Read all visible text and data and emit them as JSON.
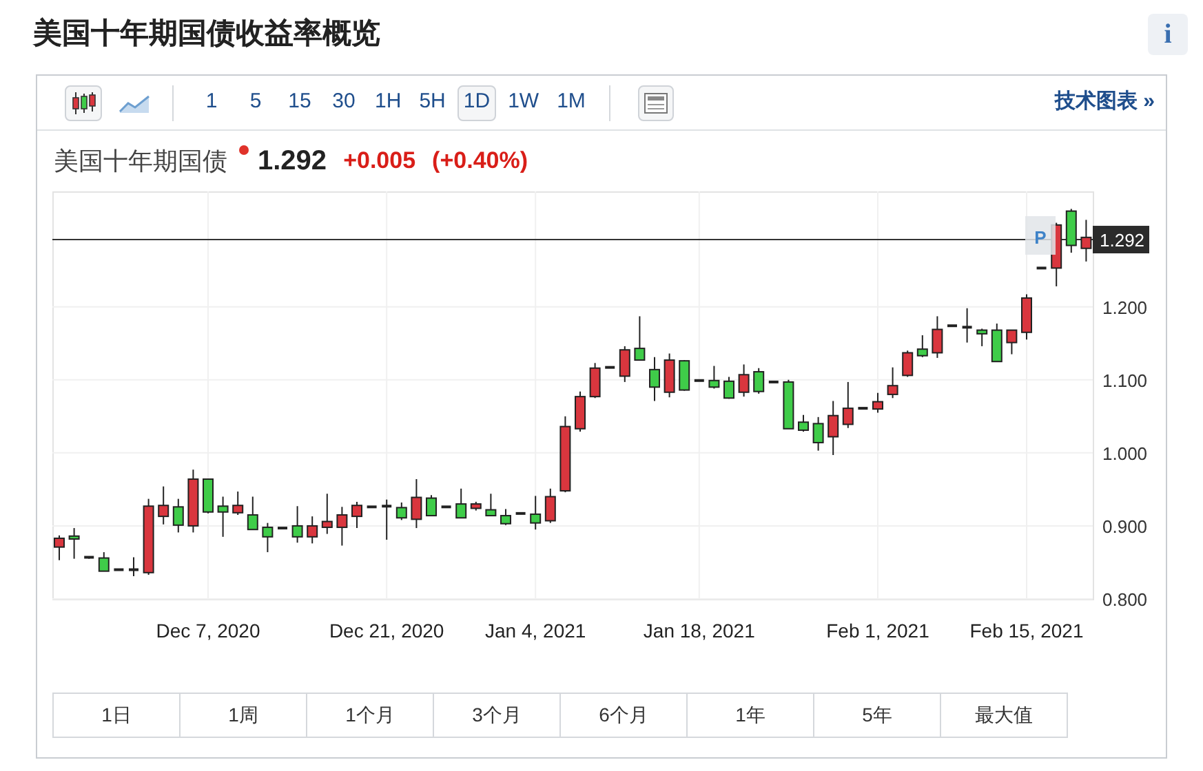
{
  "page_title": "美国十年期国债收益率概览",
  "info_button": {
    "label": "i"
  },
  "toolbar": {
    "chart_types": [
      {
        "kind": "candles",
        "selected": true
      },
      {
        "kind": "area",
        "selected": false
      }
    ],
    "intervals": [
      {
        "label": "1",
        "selected": false
      },
      {
        "label": "5",
        "selected": false
      },
      {
        "label": "15",
        "selected": false
      },
      {
        "label": "30",
        "selected": false
      },
      {
        "label": "1H",
        "selected": false
      },
      {
        "label": "5H",
        "selected": false
      },
      {
        "label": "1D",
        "selected": true
      },
      {
        "label": "1W",
        "selected": false
      },
      {
        "label": "1M",
        "selected": false
      }
    ],
    "technical_link": "技术图表 »"
  },
  "quote": {
    "name": "美国十年期国债",
    "price": "1.292",
    "change": "+0.005",
    "change_percent": "(+0.40%)"
  },
  "chart": {
    "marker": "P",
    "chart_data": {
      "type": "candlestick",
      "ylim": [
        0.8,
        1.358
      ],
      "grid": true,
      "ref_lines": [
        {
          "axis": "y",
          "value": 1.292,
          "label": "1.292"
        }
      ],
      "yticks": [
        {
          "value": 1.2,
          "label": "1.200"
        },
        {
          "value": 1.1,
          "label": "1.100"
        },
        {
          "value": 1.0,
          "label": "1.000"
        },
        {
          "value": 0.9,
          "label": "0.900"
        },
        {
          "value": 0.8,
          "label": "0.800"
        }
      ],
      "categories": [
        null,
        null,
        null,
        null,
        null,
        null,
        null,
        null,
        null,
        null,
        "Dec 7, 2020",
        null,
        null,
        null,
        null,
        null,
        null,
        null,
        null,
        null,
        null,
        null,
        "Dec 21, 2020",
        null,
        null,
        null,
        null,
        null,
        null,
        null,
        null,
        null,
        "Jan 4, 2021",
        null,
        null,
        null,
        null,
        null,
        null,
        null,
        null,
        null,
        null,
        "Jan 18, 2021",
        null,
        null,
        null,
        null,
        null,
        null,
        null,
        null,
        null,
        null,
        null,
        "Feb 1, 2021",
        null,
        null,
        null,
        null,
        null,
        null,
        null,
        null,
        null,
        "Feb 15, 2021",
        null,
        null,
        null,
        null
      ],
      "ohlc": [
        [
          0.871,
          0.887,
          0.853,
          0.883
        ],
        [
          0.886,
          0.897,
          0.855,
          0.882
        ],
        [
          0.857,
          0.857,
          0.855,
          0.856
        ],
        [
          0.856,
          0.864,
          0.838,
          0.838
        ],
        [
          0.84,
          0.84,
          0.84,
          0.84
        ],
        [
          0.84,
          0.857,
          0.831,
          0.84
        ],
        [
          0.836,
          0.937,
          0.833,
          0.927
        ],
        [
          0.913,
          0.954,
          0.902,
          0.928
        ],
        [
          0.926,
          0.937,
          0.891,
          0.901
        ],
        [
          0.9,
          0.977,
          0.891,
          0.964
        ],
        [
          0.964,
          0.964,
          0.917,
          0.919
        ],
        [
          0.927,
          0.94,
          0.885,
          0.919
        ],
        [
          0.918,
          0.947,
          0.915,
          0.928
        ],
        [
          0.915,
          0.94,
          0.895,
          0.895
        ],
        [
          0.898,
          0.904,
          0.864,
          0.885
        ],
        [
          0.897,
          0.897,
          0.897,
          0.897
        ],
        [
          0.9,
          0.927,
          0.877,
          0.885
        ],
        [
          0.885,
          0.913,
          0.876,
          0.9
        ],
        [
          0.898,
          0.944,
          0.889,
          0.906
        ],
        [
          0.898,
          0.926,
          0.873,
          0.915
        ],
        [
          0.913,
          0.933,
          0.897,
          0.928
        ],
        [
          0.926,
          0.926,
          0.926,
          0.926
        ],
        [
          0.927,
          0.936,
          0.881,
          0.927
        ],
        [
          0.925,
          0.932,
          0.908,
          0.911
        ],
        [
          0.909,
          0.964,
          0.897,
          0.939
        ],
        [
          0.938,
          0.942,
          0.913,
          0.914
        ],
        [
          0.926,
          0.926,
          0.926,
          0.926
        ],
        [
          0.93,
          0.951,
          0.911,
          0.911
        ],
        [
          0.924,
          0.933,
          0.921,
          0.93
        ],
        [
          0.922,
          0.944,
          0.914,
          0.914
        ],
        [
          0.914,
          0.923,
          0.901,
          0.903
        ],
        [
          0.917,
          0.917,
          0.917,
          0.917
        ],
        [
          0.916,
          0.941,
          0.895,
          0.904
        ],
        [
          0.907,
          0.951,
          0.904,
          0.94
        ],
        [
          0.948,
          1.05,
          0.946,
          1.036
        ],
        [
          1.033,
          1.084,
          1.029,
          1.077
        ],
        [
          1.077,
          1.123,
          1.075,
          1.116
        ],
        [
          1.117,
          1.117,
          1.117,
          1.117
        ],
        [
          1.105,
          1.146,
          1.097,
          1.141
        ],
        [
          1.143,
          1.187,
          1.127,
          1.127
        ],
        [
          1.114,
          1.131,
          1.071,
          1.09
        ],
        [
          1.083,
          1.136,
          1.076,
          1.127
        ],
        [
          1.126,
          1.127,
          1.085,
          1.086
        ],
        [
          1.099,
          1.099,
          1.099,
          1.099
        ],
        [
          1.099,
          1.119,
          1.088,
          1.09
        ],
        [
          1.098,
          1.104,
          1.074,
          1.075
        ],
        [
          1.083,
          1.121,
          1.077,
          1.107
        ],
        [
          1.111,
          1.116,
          1.081,
          1.084
        ],
        [
          1.097,
          1.097,
          1.097,
          1.097
        ],
        [
          1.097,
          1.1,
          1.033,
          1.033
        ],
        [
          1.042,
          1.052,
          1.029,
          1.031
        ],
        [
          1.04,
          1.049,
          1.003,
          1.014
        ],
        [
          1.022,
          1.071,
          0.997,
          1.051
        ],
        [
          1.039,
          1.097,
          1.034,
          1.061
        ],
        [
          1.061,
          1.061,
          1.061,
          1.061
        ],
        [
          1.06,
          1.082,
          1.055,
          1.07
        ],
        [
          1.08,
          1.117,
          1.075,
          1.092
        ],
        [
          1.106,
          1.14,
          1.104,
          1.137
        ],
        [
          1.142,
          1.161,
          1.131,
          1.133
        ],
        [
          1.137,
          1.187,
          1.13,
          1.169
        ],
        [
          1.174,
          1.174,
          1.174,
          1.174
        ],
        [
          1.172,
          1.198,
          1.151,
          1.172
        ],
        [
          1.168,
          1.17,
          1.146,
          1.163
        ],
        [
          1.168,
          1.177,
          1.125,
          1.125
        ],
        [
          1.151,
          1.168,
          1.135,
          1.168
        ],
        [
          1.165,
          1.217,
          1.155,
          1.212
        ],
        [
          1.253,
          1.253,
          1.253,
          1.253
        ],
        [
          1.253,
          1.315,
          1.228,
          1.312
        ],
        [
          1.331,
          1.334,
          1.274,
          1.284
        ],
        [
          1.28,
          1.319,
          1.262,
          1.295
        ]
      ]
    }
  },
  "ranges": [
    {
      "label": "1日"
    },
    {
      "label": "1周"
    },
    {
      "label": "1个月"
    },
    {
      "label": "3个月"
    },
    {
      "label": "6个月"
    },
    {
      "label": "1年"
    },
    {
      "label": "5年"
    },
    {
      "label": "最大值"
    }
  ]
}
